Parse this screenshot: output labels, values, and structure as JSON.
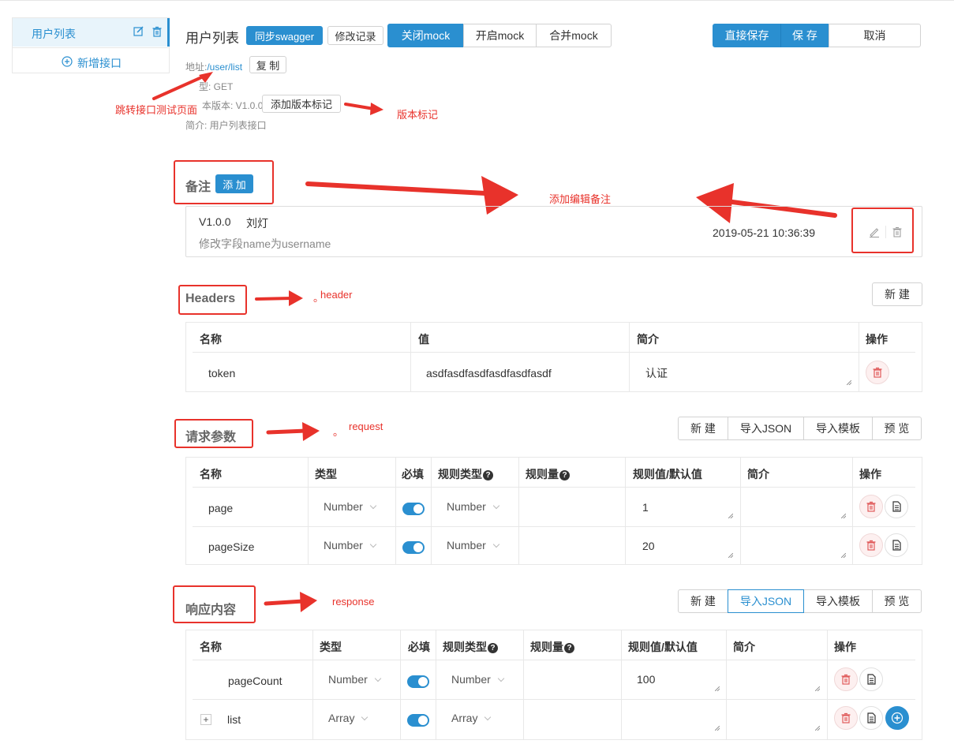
{
  "sidebar": {
    "item_label": "用户列表",
    "add_label": "新增接口"
  },
  "header": {
    "title": "用户列表",
    "sync_label": "同步swagger",
    "history_label": "修改记录",
    "mock_close": "关闭mock",
    "mock_open": "开启mock",
    "mock_merge": "合并mock",
    "save_direct": "直接保存",
    "save": "保 存",
    "cancel": "取消"
  },
  "meta": {
    "address_label": "地址:",
    "address_value": "/user/list",
    "copy_label": "复 制",
    "type_line": "型: GET",
    "version_line": "本版本: V1.0.0",
    "add_version_label": "添加版本标记",
    "desc_line": "简介: 用户列表接口"
  },
  "annotations": {
    "jump": "跳转接口测试页面",
    "version_tag": "版本标记",
    "remark_edit": "添加编辑备注",
    "header": "header",
    "request": "request",
    "response": "response",
    "dot": "。"
  },
  "remark": {
    "title": "备注",
    "add_label": "添 加",
    "version": "V1.0.0",
    "author": "刘灯",
    "content": "修改字段name为username",
    "time": "2019-05-21 10:36:39"
  },
  "headers": {
    "title": "Headers",
    "new_label": "新 建",
    "columns": [
      "名称",
      "值",
      "简介",
      "操作"
    ],
    "rows": [
      {
        "name": "token",
        "value": "asdfasdfasdfasdfasdfasdf",
        "desc": "认证"
      }
    ]
  },
  "request": {
    "title": "请求参数",
    "buttons": [
      "新 建",
      "导入JSON",
      "导入模板",
      "预 览"
    ],
    "columns": [
      "名称",
      "类型",
      "必填",
      "规则类型",
      "规则量",
      "规则值/默认值",
      "简介",
      "操作"
    ],
    "rows": [
      {
        "name": "page",
        "type": "Number",
        "rule_type": "Number",
        "value": "1"
      },
      {
        "name": "pageSize",
        "type": "Number",
        "rule_type": "Number",
        "value": "20"
      }
    ]
  },
  "response": {
    "title": "响应内容",
    "buttons": [
      "新 建",
      "导入JSON",
      "导入模板",
      "预 览"
    ],
    "columns": [
      "名称",
      "类型",
      "必填",
      "规则类型",
      "规则量",
      "规则值/默认值",
      "简介",
      "操作"
    ],
    "rows": [
      {
        "name": "pageCount",
        "type": "Number",
        "rule_type": "Number",
        "value": "100"
      },
      {
        "name": "list",
        "type": "Array",
        "rule_type": "Array",
        "value": "",
        "expander": "+"
      }
    ]
  },
  "colors": {
    "accent": "#2a8fd0",
    "annotation": "#e8322b",
    "danger": "#e05a5a"
  }
}
